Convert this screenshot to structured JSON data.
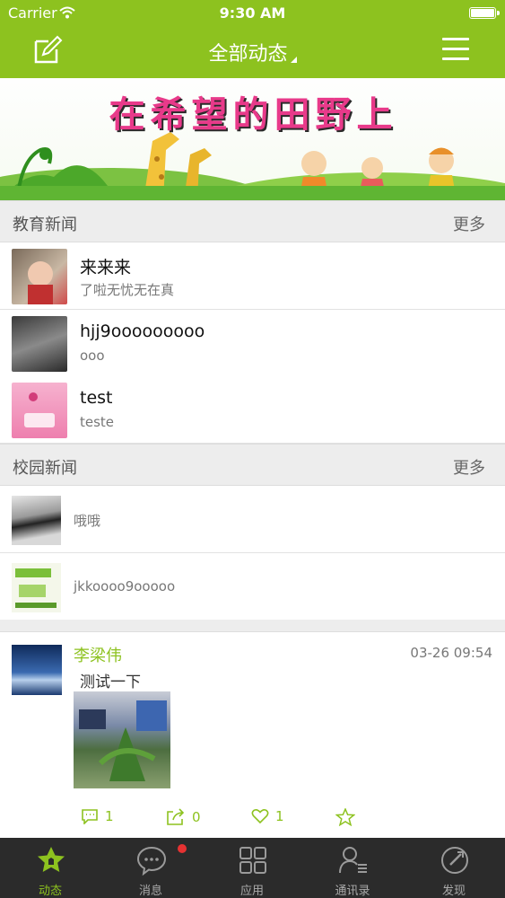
{
  "status_bar": {
    "carrier": "Carrier",
    "time": "9:30 AM"
  },
  "nav": {
    "title": "全部动态",
    "left_icon": "edit-icon",
    "right_icon": "menu-icon"
  },
  "banner": {
    "text": "在希望的田野上"
  },
  "education_news": {
    "label": "教育新闻",
    "more": "更多",
    "items": [
      {
        "title": "来来来",
        "subtitle": "了啦无忧无在真"
      },
      {
        "title": "hjj9ooooooooo",
        "subtitle": "ooo"
      },
      {
        "title": "test",
        "subtitle": "teste"
      }
    ]
  },
  "campus_news": {
    "label": "校园新闻",
    "more": "更多",
    "items": [
      {
        "title": "哦哦"
      },
      {
        "title": "jkkoooo9ooooo"
      }
    ]
  },
  "post": {
    "author": "李梁伟",
    "time": "03-26 09:54",
    "text": "测试一下",
    "comment_count": "1",
    "share_count": "0",
    "like_count": "1"
  },
  "tabbar": {
    "items": [
      {
        "label": "动态",
        "icon": "home-star-icon",
        "active": true
      },
      {
        "label": "消息",
        "icon": "message-bubble-icon",
        "badge": true
      },
      {
        "label": "应用",
        "icon": "apps-grid-icon"
      },
      {
        "label": "通讯录",
        "icon": "contacts-icon"
      },
      {
        "label": "发现",
        "icon": "compass-icon"
      }
    ]
  },
  "colors": {
    "accent": "#8dc21f",
    "tabbar": "#2b2b2b",
    "section_bg": "#ededed",
    "badge": "#e63232"
  }
}
